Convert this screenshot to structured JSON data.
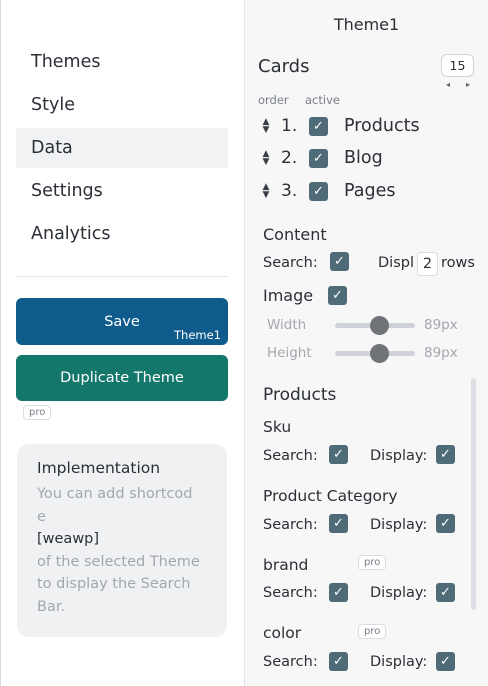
{
  "sidebar": {
    "items": [
      {
        "label": "Themes",
        "active": false
      },
      {
        "label": "Style",
        "active": false
      },
      {
        "label": "Data",
        "active": true
      },
      {
        "label": "Settings",
        "active": false
      },
      {
        "label": "Analytics",
        "active": false
      }
    ],
    "save_label": "Save",
    "save_sub": "Theme1",
    "duplicate_label": "Duplicate Theme",
    "pro_badge": "pro"
  },
  "implementation": {
    "title": "Implementation",
    "line1": "You can add shortcod",
    "line2": "e",
    "code": "[weawp]",
    "line3": "of the selected Theme",
    "line4": "to display the Search",
    "line5": "Bar."
  },
  "panel": {
    "theme_title": "Theme1",
    "cards_title": "Cards",
    "cards_count": "15",
    "order_label": "order",
    "active_label": "active",
    "order_items": [
      {
        "num": "1.",
        "label": "Products",
        "checked": true
      },
      {
        "num": "2.",
        "label": "Blog",
        "checked": true
      },
      {
        "num": "3.",
        "label": "Pages",
        "checked": true
      }
    ],
    "content": {
      "title": "Content",
      "search_label": "Search:",
      "display_label": "Displ",
      "rows_value": "2",
      "rows_label": "rows"
    },
    "image": {
      "label": "Image",
      "width_label": "Width",
      "width_value": "89px",
      "width_fraction": 0.55,
      "height_label": "Height",
      "height_value": "89px",
      "height_fraction": 0.55
    },
    "products": {
      "title": "Products",
      "search_label": "Search:",
      "display_label": "Display:",
      "fields": [
        {
          "name": "Sku",
          "pro": ""
        },
        {
          "name": "Product Category",
          "pro": ""
        },
        {
          "name": "brand",
          "pro": "pro"
        },
        {
          "name": "color",
          "pro": "pro"
        }
      ]
    }
  },
  "colors": {
    "save_button": "#0f5c8c",
    "duplicate_button": "#13776c",
    "checkbox": "#4f6b78"
  }
}
